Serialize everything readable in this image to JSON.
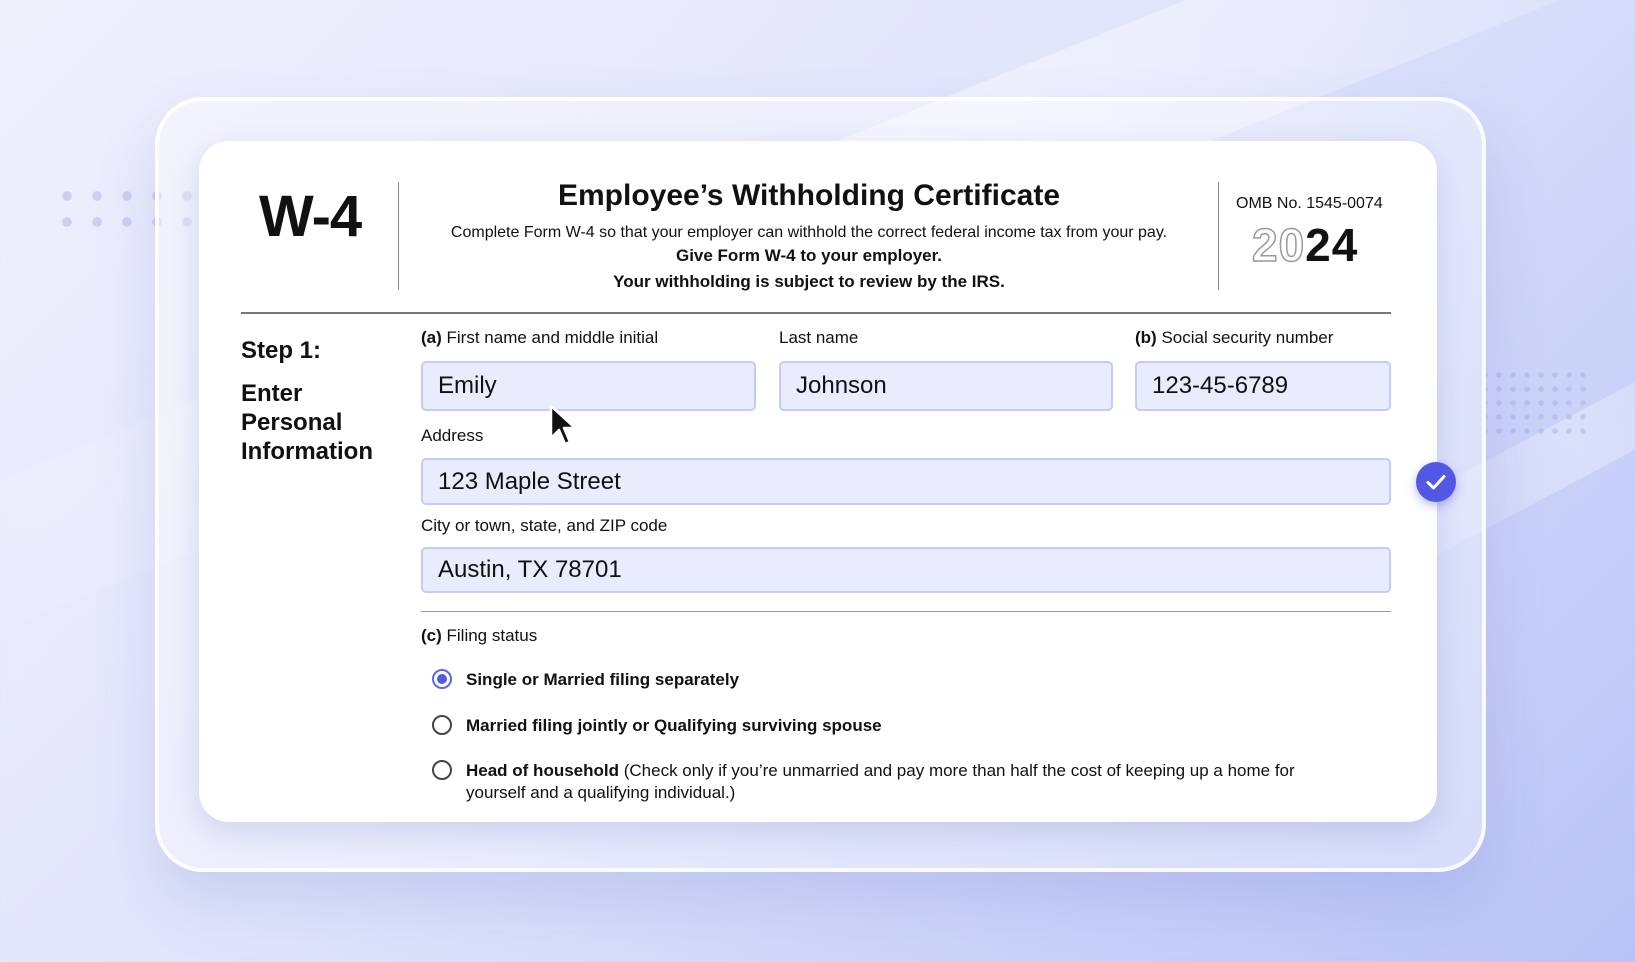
{
  "header": {
    "form_id": "W-4",
    "title": "Employee’s Withholding Certificate",
    "subtitle": "Complete Form W-4 so that your employer can withhold the correct federal income tax from your pay.",
    "give_line": "Give Form W-4 to your employer.",
    "review_line": "Your withholding is subject to review by the IRS.",
    "omb": "OMB No. 1545-0074",
    "year_prefix": "20",
    "year_suffix": "24"
  },
  "step": {
    "label": "Step 1:",
    "description": "Enter Personal Information"
  },
  "fields": {
    "first_name": {
      "prefix": "(a)",
      "label": "First name and middle initial",
      "value": "Emily"
    },
    "last_name": {
      "label": "Last name",
      "value": "Johnson"
    },
    "ssn": {
      "prefix": "(b)",
      "label": "Social security number",
      "value": "123-45-6789"
    },
    "address": {
      "label": "Address",
      "value": "123 Maple Street"
    },
    "city": {
      "label": "City or town, state, and ZIP code",
      "value": "Austin, TX 78701"
    }
  },
  "filing_status": {
    "prefix": "(c)",
    "label": "Filing status",
    "options": [
      {
        "label": "Single or Married filing separately",
        "selected": true
      },
      {
        "label": "Married filing jointly or Qualifying surviving spouse",
        "selected": false
      },
      {
        "label": "Head of household",
        "note": "(Check only if you’re unmarried and pay more than half the cost of keeping up a home for yourself and a qualifying individual.)",
        "selected": false
      }
    ]
  },
  "colors": {
    "accent": "#5159e4",
    "field_bg": "#e9ecfc",
    "field_border": "#c4cbf4"
  },
  "icons": {
    "validation": "check-icon",
    "pointer": "mouse-cursor-icon"
  }
}
